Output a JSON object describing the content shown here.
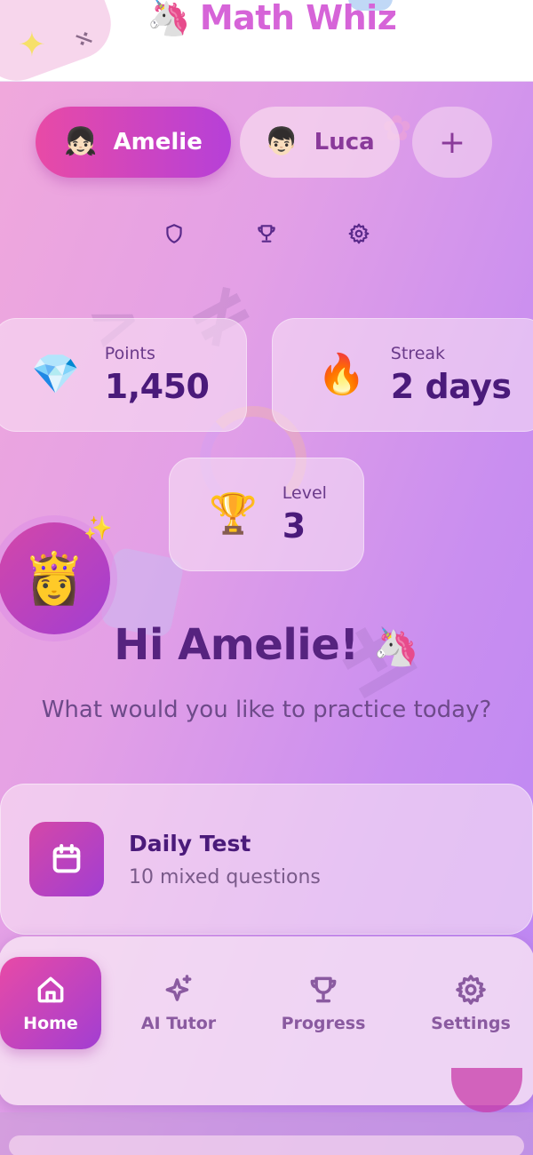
{
  "app": {
    "title": "Math Whiz",
    "logo_emoji": "🦄",
    "background_colors": [
      "#f0a8dc",
      "#bb86f4"
    ]
  },
  "profiles": [
    {
      "name": "Amelie",
      "emoji": "👧🏻",
      "selected": true
    },
    {
      "name": "Luca",
      "emoji": "👦🏻",
      "selected": false
    }
  ],
  "add_profile_label": "+",
  "quick_icons": [
    "shield-icon",
    "trophy-icon",
    "gear-icon"
  ],
  "stats": {
    "points": {
      "label": "Points",
      "value": "1,450",
      "emoji": "💎"
    },
    "streak": {
      "label": "Streak",
      "value": "2 days",
      "emoji": "🔥"
    },
    "level": {
      "label": "Level",
      "value": "3",
      "emoji": "🏆"
    }
  },
  "avatar": {
    "emoji": "👸",
    "sparkle": "✨"
  },
  "greeting": {
    "text": "Hi Amelie!",
    "emoji": "🦄"
  },
  "subtitle": "What would you like to practice today?",
  "daily_test": {
    "title": "Daily Test",
    "subtitle": "10 mixed questions",
    "icon": "calendar-icon"
  },
  "nav": {
    "items": [
      {
        "label": "Home",
        "icon": "home-icon",
        "active": true
      },
      {
        "label": "AI Tutor",
        "icon": "sparkles-icon",
        "active": false
      },
      {
        "label": "Progress",
        "icon": "trophy-icon",
        "active": false
      },
      {
        "label": "Settings",
        "icon": "gear-icon",
        "active": false
      }
    ]
  },
  "colors": {
    "accent_pink": "#e84aa6",
    "accent_purple": "#a23ed2",
    "text_dark": "#4a1a7a"
  }
}
